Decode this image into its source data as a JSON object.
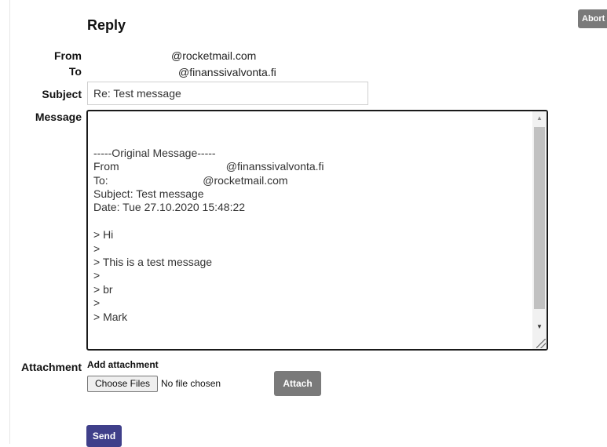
{
  "page": {
    "title": "Reply",
    "abort_label": "Abort"
  },
  "header": {
    "from_label": "From",
    "from_value": "@rocketmail.com",
    "to_label": "To",
    "to_value": "@finanssivalvonta.fi"
  },
  "subject": {
    "label": "Subject",
    "value": "Re: Test message"
  },
  "message": {
    "label": "Message",
    "body": "\n\n-----Original Message-----\nFrom                                   @finanssivalvonta.fi\nTo:                               @rocketmail.com\nSubject: Test message\nDate: Tue 27.10.2020 15:48:22\n\n> Hi\n>\n> This is a test message\n>\n> br\n>\n> Mark"
  },
  "attachment": {
    "label": "Attachment",
    "add_label": "Add attachment",
    "choose_files_label": "Choose Files",
    "no_file_text": "No file chosen",
    "attach_label": "Attach"
  },
  "actions": {
    "send_label": "Send"
  },
  "colors": {
    "send_button": "#3f3f8a",
    "grey_button": "#7a7a7a"
  }
}
